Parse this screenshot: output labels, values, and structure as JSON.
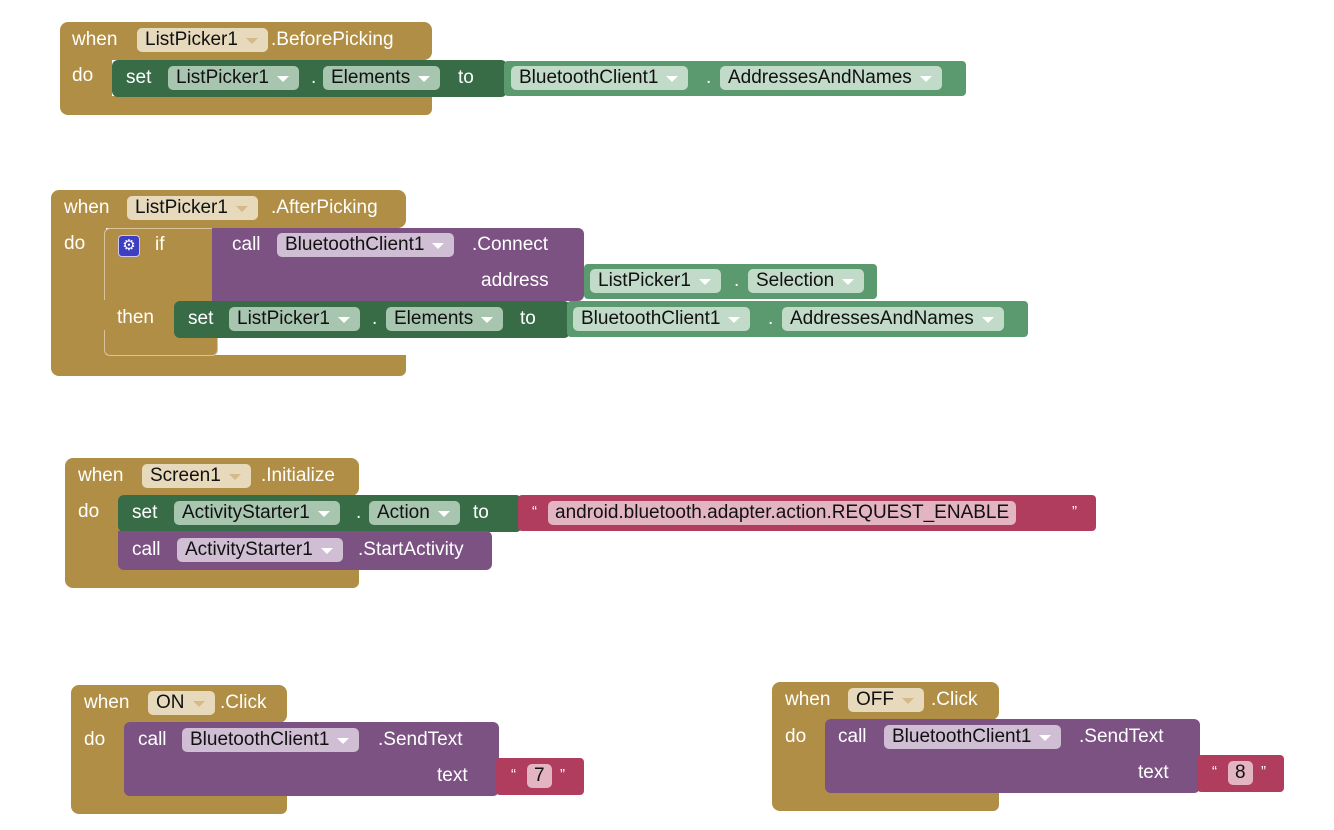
{
  "blocks": [
    {
      "event": {
        "when": "when",
        "component": "ListPicker1",
        "name": ".BeforePicking",
        "do": "do"
      },
      "set": {
        "keyword": "set",
        "component": "ListPicker1",
        "property": "Elements",
        "to": "to"
      },
      "value": {
        "component": "BluetoothClient1",
        "property": "AddressesAndNames"
      }
    },
    {
      "event": {
        "when": "when",
        "component": "ListPicker1",
        "name": ".AfterPicking",
        "do": "do"
      },
      "if": {
        "keyword": "if",
        "then": "then",
        "icon": "gear-icon"
      },
      "call": {
        "keyword": "call",
        "component": "BluetoothClient1",
        "method": ".Connect",
        "arg_label": "address"
      },
      "arg": {
        "component": "ListPicker1",
        "property": "Selection"
      },
      "set": {
        "keyword": "set",
        "component": "ListPicker1",
        "property": "Elements",
        "to": "to"
      },
      "value": {
        "component": "BluetoothClient1",
        "property": "AddressesAndNames"
      }
    },
    {
      "event": {
        "when": "when",
        "component": "Screen1",
        "name": ".Initialize",
        "do": "do"
      },
      "set": {
        "keyword": "set",
        "component": "ActivityStarter1",
        "property": "Action",
        "to": "to"
      },
      "value": {
        "open_quote": "“",
        "text": "android.bluetooth.adapter.action.REQUEST_ENABLE",
        "close_quote": "”"
      },
      "call": {
        "keyword": "call",
        "component": "ActivityStarter1",
        "method": ".StartActivity"
      }
    },
    {
      "event": {
        "when": "when",
        "component": "ON",
        "name": ".Click",
        "do": "do"
      },
      "call": {
        "keyword": "call",
        "component": "BluetoothClient1",
        "method": ".SendText",
        "arg_label": "text"
      },
      "value": {
        "open_quote": "“",
        "text": "7",
        "close_quote": "”"
      }
    },
    {
      "event": {
        "when": "when",
        "component": "OFF",
        "name": ".Click",
        "do": "do"
      },
      "call": {
        "keyword": "call",
        "component": "BluetoothClient1",
        "method": ".SendText",
        "arg_label": "text"
      },
      "value": {
        "open_quote": "“",
        "text": "8",
        "close_quote": "”"
      }
    }
  ],
  "dot": ".",
  "colors": {
    "event": "#b18e45",
    "setter": "#376c47",
    "getter": "#5b9a6e",
    "call": "#7b5282",
    "text": "#b13d5e"
  }
}
